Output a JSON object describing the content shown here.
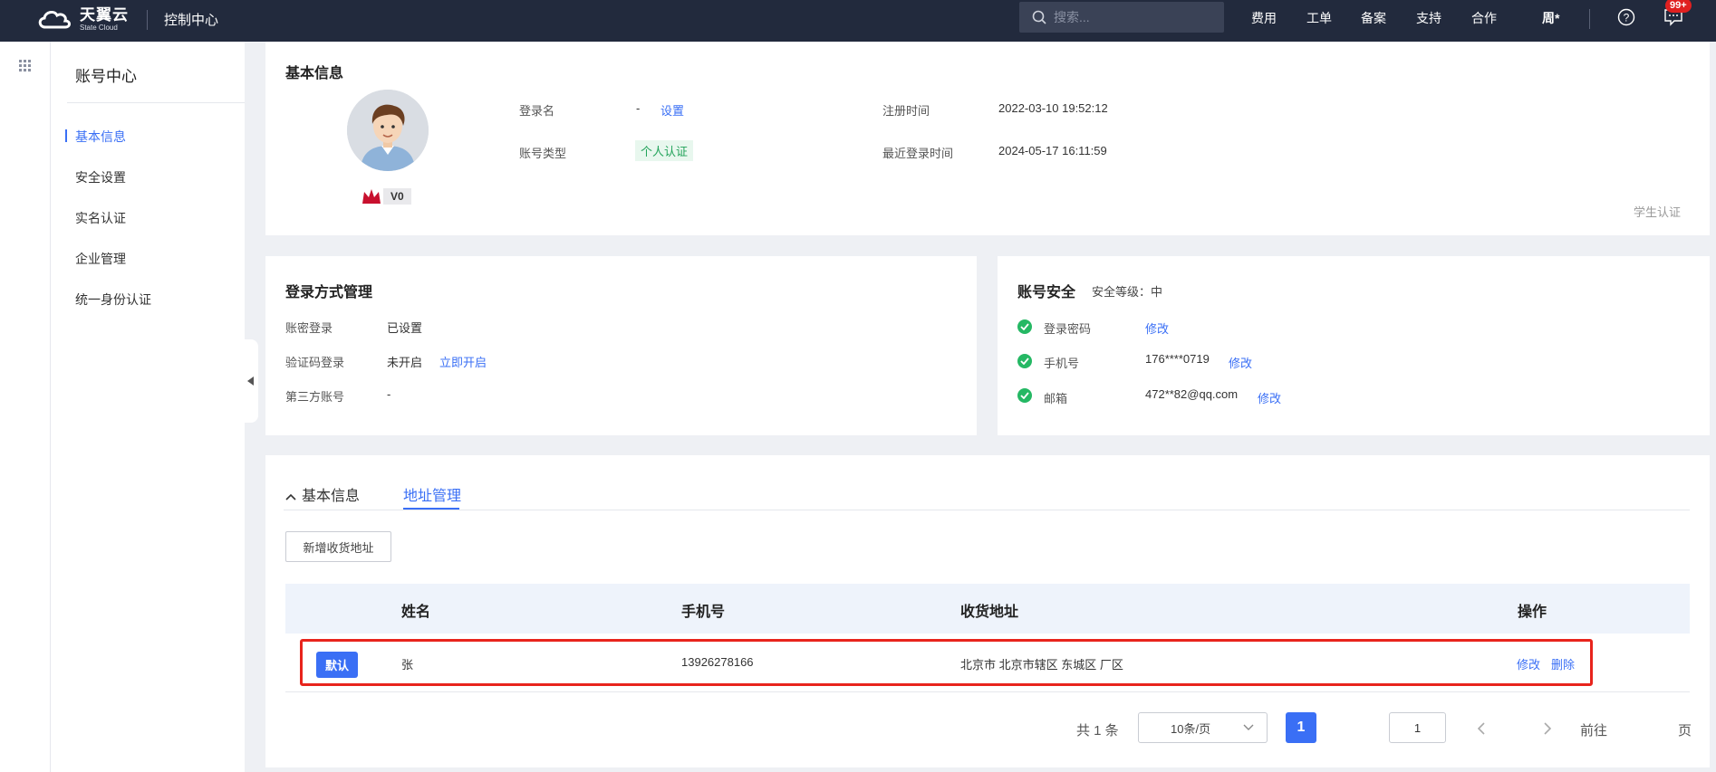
{
  "topbar": {
    "logo_cn": "天翼云",
    "logo_en": "State Cloud",
    "console_title": "控制中心",
    "search_placeholder": "搜索...",
    "nav": [
      "费用",
      "工单",
      "备案",
      "支持",
      "合作"
    ],
    "user": "周*",
    "notification_badge": "99+",
    "bg_color": "#222a3d"
  },
  "sidebar": {
    "title": "账号中心",
    "items": [
      "基本信息",
      "安全设置",
      "实名认证",
      "企业管理",
      "统一身份认证"
    ],
    "active_index": 0
  },
  "basic_info": {
    "title": "基本信息",
    "level": "V0",
    "login_name_label": "登录名",
    "login_name_value": "-",
    "login_name_action": "设置",
    "account_type_label": "账号类型",
    "account_type_value": "个人认证",
    "register_time_label": "注册时间",
    "register_time_value": "2022-03-10 19:52:12",
    "last_login_label": "最近登录时间",
    "last_login_value": "2024-05-17 16:11:59",
    "student_cert": "学生认证"
  },
  "login_methods": {
    "title": "登录方式管理",
    "rows": [
      {
        "label": "账密登录",
        "value": "已设置",
        "action": ""
      },
      {
        "label": "验证码登录",
        "value": "未开启",
        "action": "立即开启"
      },
      {
        "label": "第三方账号",
        "value": "-",
        "action": ""
      }
    ]
  },
  "account_security": {
    "title": "账号安全",
    "level_text": "安全等级：中",
    "rows": [
      {
        "label": "登录密码",
        "value": "",
        "action": "修改"
      },
      {
        "label": "手机号",
        "value": "176****0719",
        "action": "修改"
      },
      {
        "label": "邮箱",
        "value": "472**82@qq.com",
        "action": "修改"
      }
    ]
  },
  "address": {
    "tab_collapse": "基本信息",
    "tab_active": "地址管理",
    "add_button": "新增收货地址",
    "columns": [
      "姓名",
      "手机号",
      "收货地址",
      "操作"
    ],
    "rows": [
      {
        "default": "默认",
        "name": "张",
        "phone": "13926278166",
        "address": "北京市 北京市辖区 东城区 厂区",
        "edit": "修改",
        "delete": "删除"
      }
    ]
  },
  "pagination": {
    "total": "共 1 条",
    "page_size": "10条/页",
    "current": "1",
    "goto_label": "前往",
    "goto_value": "1",
    "page_unit": "页"
  },
  "colors": {
    "accent": "#3a6ff5",
    "success": "#25b864",
    "highlight": "#e8241c"
  }
}
